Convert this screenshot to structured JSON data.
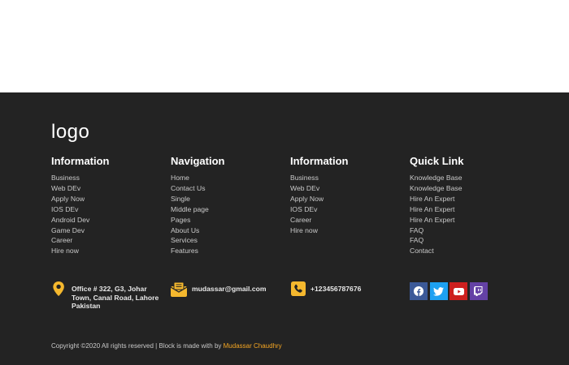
{
  "footer": {
    "logo": "logo",
    "columns": [
      {
        "title": "Information",
        "items": [
          "Business",
          "Web DEv",
          "Apply Now",
          "IOS DEv",
          "Android Dev",
          "Game Dev",
          "Career",
          "Hire now"
        ]
      },
      {
        "title": "Navigation",
        "items": [
          "Home",
          "Contact Us",
          "Single",
          "Middle page",
          "Pages",
          "About Us",
          "Services",
          "Features"
        ]
      },
      {
        "title": "Information",
        "items": [
          "Business",
          "Web DEv",
          "Apply Now",
          "IOS DEv",
          "Career",
          "Hire now"
        ]
      },
      {
        "title": "Quick Link",
        "items": [
          "Knowledge Base",
          "Knowledge Base",
          "Hire An Expert",
          "Hire An Expert",
          "Hire An Expert",
          "FAQ",
          "FAQ",
          "Contact"
        ]
      }
    ],
    "contact": {
      "address": "Office # 322, G3, Johar Town, Canal Road, Lahore Pakistan",
      "email": "mudassar@gmail.com",
      "phone": "+123456787676"
    },
    "social": [
      {
        "icon": "facebook-icon",
        "color": "#3b5998"
      },
      {
        "icon": "twitter-icon",
        "color": "#1da1f2"
      },
      {
        "icon": "youtube-icon",
        "color": "#cd201f"
      },
      {
        "icon": "twitch-icon",
        "color": "#6441a5"
      }
    ],
    "copyright_prefix": "Copyright ©2020 All rights reserved | Block is made with by",
    "copyright_author": "Mudassar Chaudhry",
    "colors": {
      "background": "#232323",
      "accent": "#f5a623",
      "text": "#c9c9c9"
    }
  }
}
